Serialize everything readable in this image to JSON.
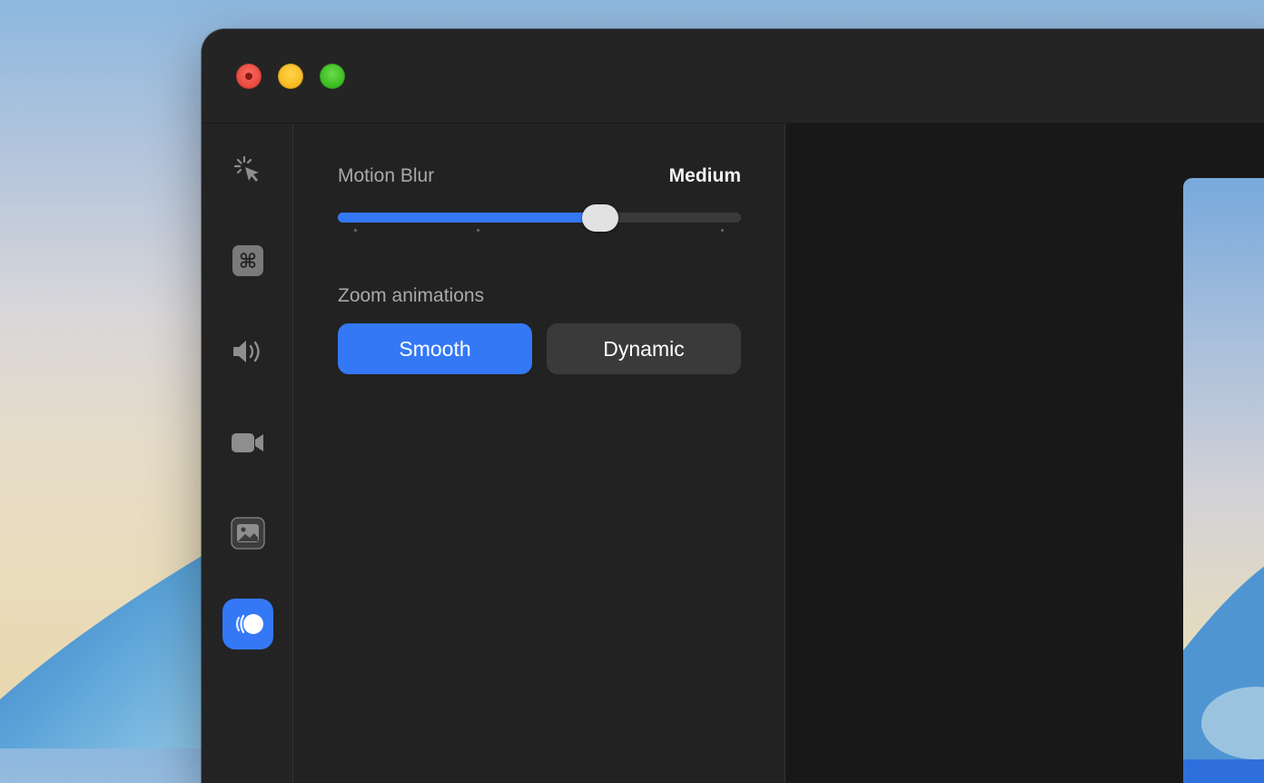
{
  "window": {
    "traffic_lights": [
      "close",
      "minimize",
      "maximize"
    ]
  },
  "sidebar": {
    "items": [
      {
        "icon": "cursor-click-icon",
        "active": false
      },
      {
        "icon": "command-key-icon",
        "active": false
      },
      {
        "icon": "speaker-icon",
        "active": false
      },
      {
        "icon": "video-camera-icon",
        "active": false
      },
      {
        "icon": "image-icon",
        "active": false
      },
      {
        "icon": "motion-animation-icon",
        "active": true
      }
    ]
  },
  "settings": {
    "motion_blur": {
      "label": "Motion Blur",
      "value_label": "Medium",
      "level": 0.65
    },
    "zoom_animations": {
      "label": "Zoom animations",
      "options": [
        "Smooth",
        "Dynamic"
      ],
      "selected": "Smooth"
    }
  },
  "colors": {
    "accent": "#3478f6",
    "window_bg": "#232323",
    "preview_bg": "#181818"
  }
}
